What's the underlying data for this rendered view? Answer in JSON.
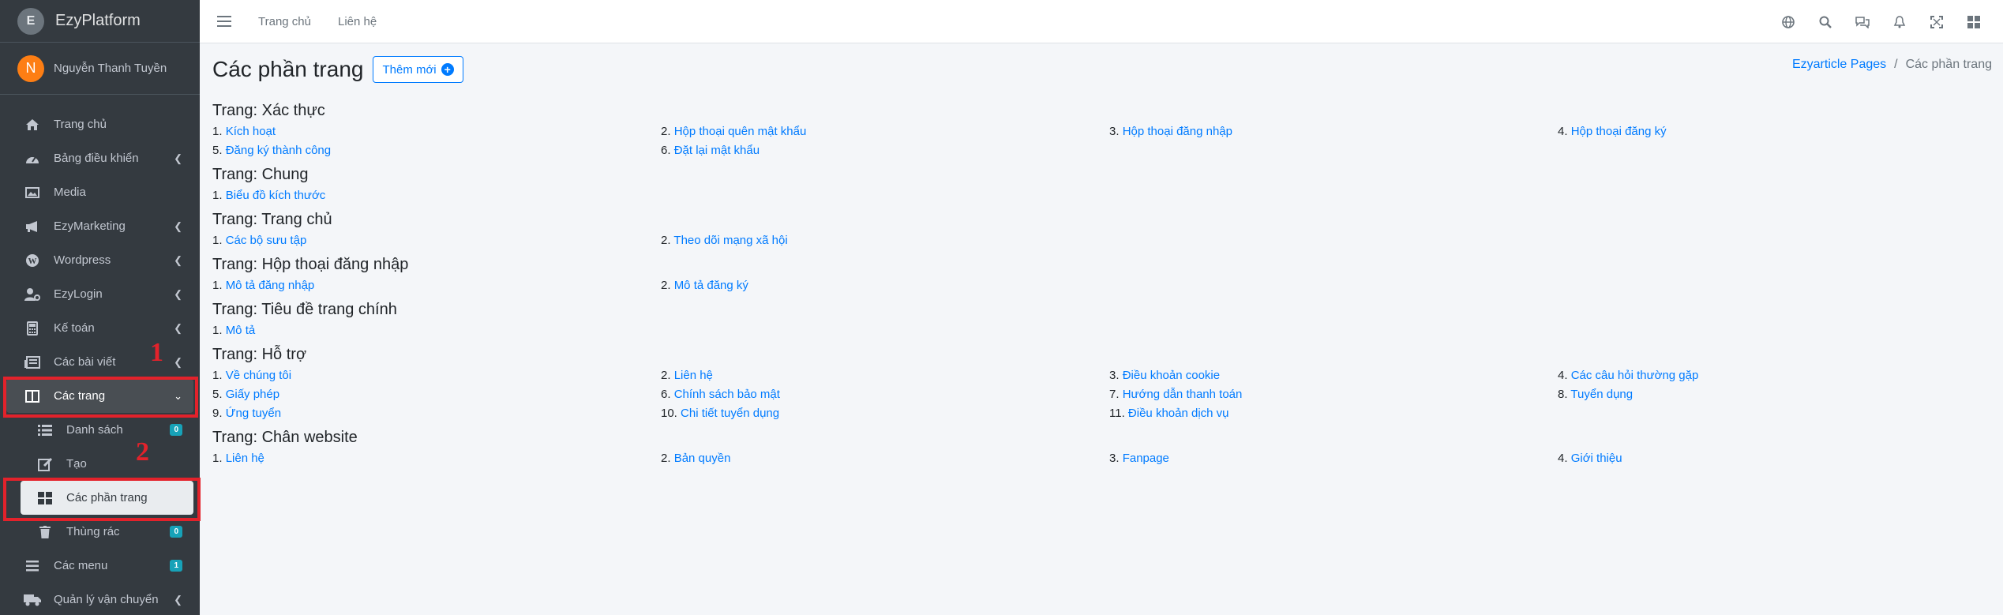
{
  "brand": {
    "name": "EzyPlatform",
    "logo_letter": "E"
  },
  "user": {
    "initial": "N",
    "name": "Nguyễn Thanh Tuyền"
  },
  "sidebar": {
    "items": [
      {
        "label": "Trang chủ",
        "icon": "home-icon"
      },
      {
        "label": "Bảng điều khiển",
        "icon": "dashboard-icon"
      },
      {
        "label": "Media",
        "icon": "image-icon"
      },
      {
        "label": "EzyMarketing",
        "icon": "megaphone-icon"
      },
      {
        "label": "Wordpress",
        "icon": "wordpress-icon"
      },
      {
        "label": "EzyLogin",
        "icon": "user-cog-icon"
      },
      {
        "label": "Kế toán",
        "icon": "calculator-icon"
      },
      {
        "label": "Các bài viết",
        "icon": "newspaper-icon"
      },
      {
        "label": "Các trang",
        "icon": "columns-icon"
      }
    ],
    "sub_items": [
      {
        "label": "Danh sách",
        "icon": "list-icon",
        "badge": "0"
      },
      {
        "label": "Tạo",
        "icon": "edit-icon"
      },
      {
        "label": "Các phần trang",
        "icon": "grid-icon"
      },
      {
        "label": "Thùng rác",
        "icon": "trash-icon",
        "badge": "0"
      }
    ],
    "after_items": [
      {
        "label": "Các menu",
        "icon": "bars-icon",
        "badge": "1"
      },
      {
        "label": "Quản lý vận chuyển",
        "icon": "truck-icon"
      }
    ]
  },
  "annotations": {
    "one": "1",
    "two": "2"
  },
  "header": {
    "home_link": "Trang chủ",
    "contact_link": "Liên hệ"
  },
  "main": {
    "title": "Các phần trang",
    "add_button": "Thêm mới",
    "breadcrumb": {
      "link": "Ezyarticle Pages",
      "sep": "/",
      "current": "Các phần trang"
    }
  },
  "sections": [
    {
      "title": "Trang: Xác thực",
      "items": [
        {
          "n": "1.",
          "label": "Kích hoạt"
        },
        {
          "n": "2.",
          "label": "Hộp thoại quên mật khẩu"
        },
        {
          "n": "3.",
          "label": "Hộp thoại đăng nhập"
        },
        {
          "n": "4.",
          "label": "Hộp thoại đăng ký"
        },
        {
          "n": "5.",
          "label": "Đăng ký thành công"
        },
        {
          "n": "6.",
          "label": "Đặt lại mật khẩu"
        }
      ]
    },
    {
      "title": "Trang: Chung",
      "items": [
        {
          "n": "1.",
          "label": "Biểu đồ kích thước"
        }
      ]
    },
    {
      "title": "Trang: Trang chủ",
      "items": [
        {
          "n": "1.",
          "label": "Các bộ sưu tập"
        },
        {
          "n": "2.",
          "label": "Theo dõi mạng xã hội"
        }
      ]
    },
    {
      "title": "Trang: Hộp thoại đăng nhập",
      "items": [
        {
          "n": "1.",
          "label": "Mô tả đăng nhập"
        },
        {
          "n": "2.",
          "label": "Mô tả đăng ký"
        }
      ]
    },
    {
      "title": "Trang: Tiêu đề trang chính",
      "items": [
        {
          "n": "1.",
          "label": "Mô tả"
        }
      ]
    },
    {
      "title": "Trang: Hỗ trợ",
      "items": [
        {
          "n": "1.",
          "label": "Về chúng tôi"
        },
        {
          "n": "2.",
          "label": "Liên hệ"
        },
        {
          "n": "3.",
          "label": "Điều khoản cookie"
        },
        {
          "n": "4.",
          "label": "Các câu hỏi thường gặp"
        },
        {
          "n": "5.",
          "label": "Giấy phép"
        },
        {
          "n": "6.",
          "label": "Chính sách bảo mật"
        },
        {
          "n": "7.",
          "label": "Hướng dẫn thanh toán"
        },
        {
          "n": "8.",
          "label": "Tuyển dụng"
        },
        {
          "n": "9.",
          "label": "Ứng tuyển"
        },
        {
          "n": "10.",
          "label": "Chi tiết tuyển dụng"
        },
        {
          "n": "11.",
          "label": "Điều khoản dịch vụ"
        }
      ]
    },
    {
      "title": "Trang: Chân website",
      "items": [
        {
          "n": "1.",
          "label": "Liên hệ"
        },
        {
          "n": "2.",
          "label": "Bản quyền"
        },
        {
          "n": "3.",
          "label": "Fanpage"
        },
        {
          "n": "4.",
          "label": "Giới thiệu"
        }
      ]
    }
  ],
  "colors": {
    "sidebar_bg": "#343a40",
    "link": "#007bff",
    "highlight": "#e3222b",
    "badge": "#17a2b8"
  }
}
